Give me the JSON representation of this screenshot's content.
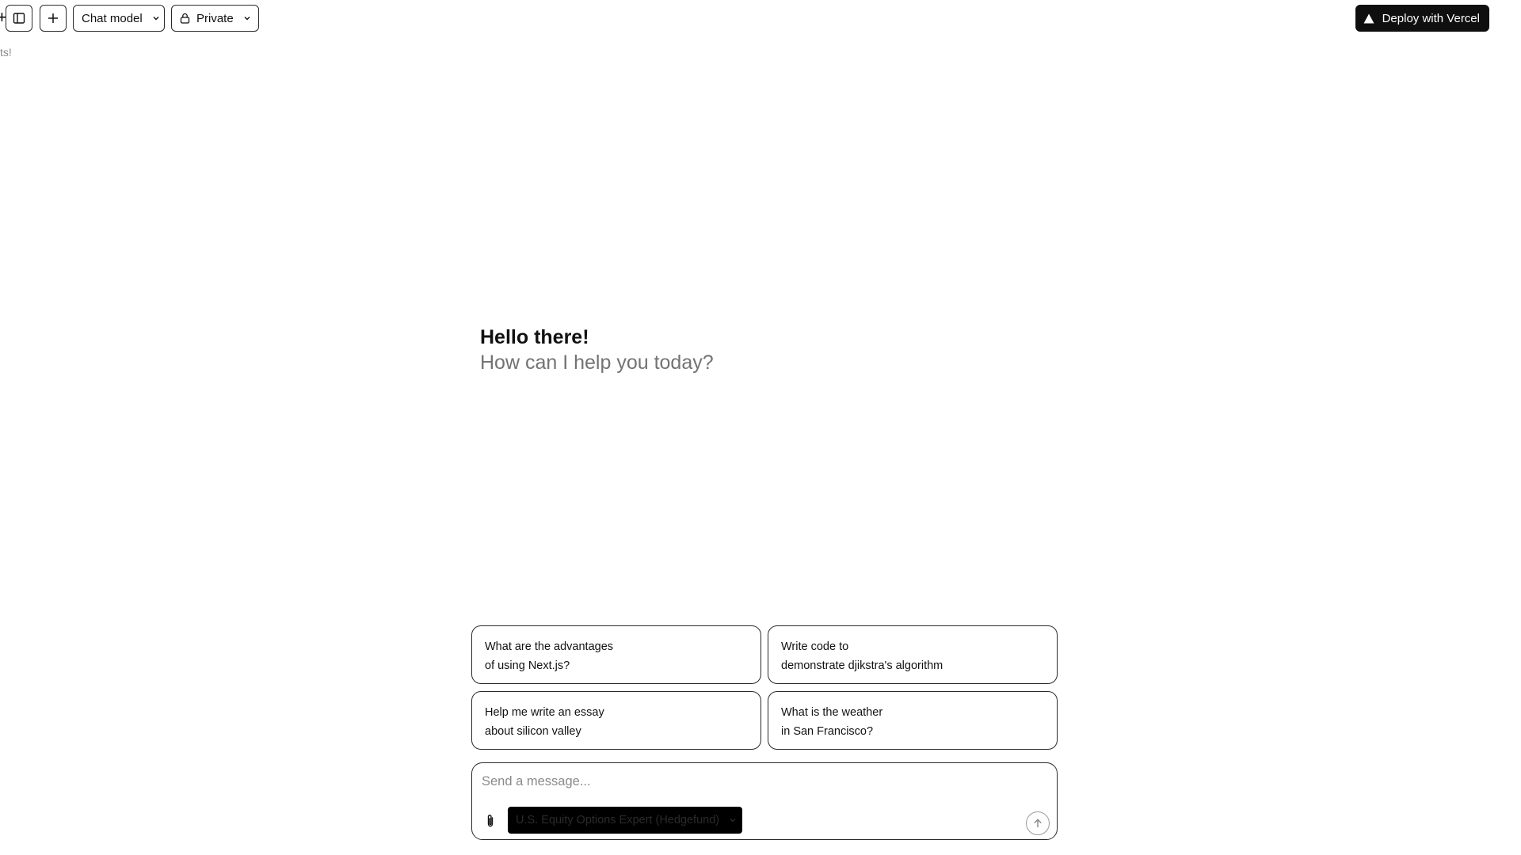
{
  "sidebar_fragment": {
    "plus_glyph": "+",
    "text": "ts!"
  },
  "header": {
    "sidebar_toggle_icon": "sidebar-toggle-icon",
    "new_chat_icon": "plus-icon",
    "chat_model_label": "Chat model",
    "visibility_label": "Private",
    "deploy_label": "Deploy with Vercel"
  },
  "greeting": {
    "title": "Hello there!",
    "subtitle": "How can I help you today?"
  },
  "suggestions": [
    {
      "line1": "What are the advantages",
      "line2": "of using Next.js?"
    },
    {
      "line1": "Write code to",
      "line2": "demonstrate djikstra's algorithm"
    },
    {
      "line1": "Help me write an essay",
      "line2": "about silicon valley"
    },
    {
      "line1": "What is the weather",
      "line2": "in San Francisco?"
    }
  ],
  "composer": {
    "placeholder": "Send a message...",
    "value": "",
    "model_selected": "U.S. Equity Options Expert (Hedgefund)"
  },
  "colors": {
    "deploy_bg": "#0f0f0f",
    "model_select_bg": "#000000",
    "border": "#2a2a2a",
    "muted_text": "#737373"
  }
}
